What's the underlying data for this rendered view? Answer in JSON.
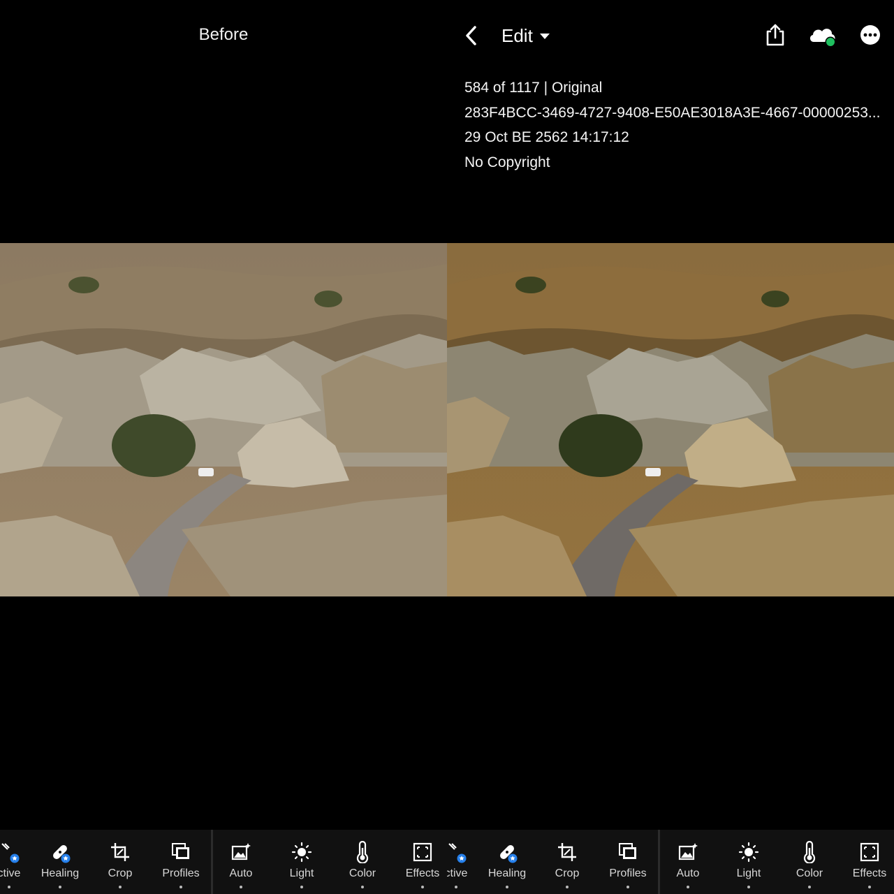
{
  "before_panel": {
    "label": "Before"
  },
  "header": {
    "mode_label": "Edit"
  },
  "info": {
    "position": "584 of 1117 | Original",
    "filename": "283F4BCC-3469-4727-9408-E50AE3018A3E-4667-00000253...",
    "datetime": "29 Oct BE 2562 14:17:12",
    "copyright": "No Copyright"
  },
  "icons": {
    "back": "chevron-left-icon",
    "caret": "caret-down-icon",
    "share": "share-icon",
    "cloud": "cloud-sync-icon",
    "more": "more-icon"
  },
  "colors": {
    "sync_status": "#1fbf5f",
    "badge": "#2680eb",
    "toolbar_bg": "#111111"
  },
  "toolbar": {
    "items": [
      {
        "label": "ctive",
        "icon": "selective-icon"
      },
      {
        "label": "Healing",
        "icon": "healing-icon"
      },
      {
        "label": "Crop",
        "icon": "crop-icon"
      },
      {
        "label": "Profiles",
        "icon": "profiles-icon"
      },
      {
        "label": "Auto",
        "icon": "auto-icon"
      },
      {
        "label": "Light",
        "icon": "light-icon"
      },
      {
        "label": "Color",
        "icon": "color-icon"
      },
      {
        "label": "Effects",
        "icon": "effects-icon"
      }
    ]
  }
}
